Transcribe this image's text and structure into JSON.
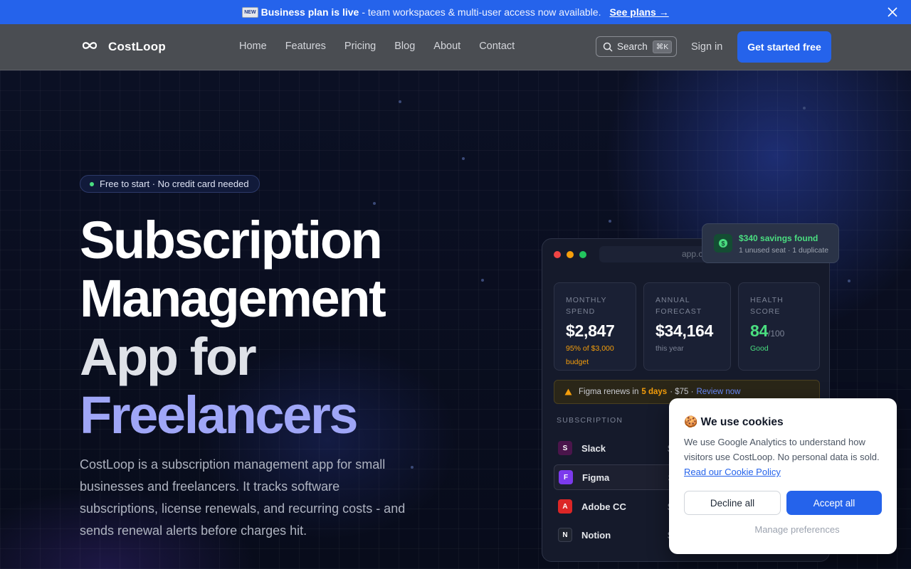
{
  "announcement": {
    "badge": "NEW",
    "bold_text": "Business plan is live",
    "rest_text": "- team workspaces & multi-user access now available.",
    "link_text": "See plans →"
  },
  "nav": {
    "brand": "CostLoop",
    "links": [
      "Home",
      "Features",
      "Pricing",
      "Blog",
      "About",
      "Contact"
    ],
    "search_label": "Search",
    "search_shortcut": "⌘K",
    "signin": "Sign in",
    "cta": "Get started free"
  },
  "hero": {
    "pill": "Free to start · No credit card needed",
    "headline": [
      "Subscription",
      "Management",
      "App for",
      "Freelancers"
    ],
    "subtext": "CostLoop is a subscription management app for small businesses and freelancers. It tracks software subscriptions, license renewals, and recurring costs - and sends renewal alerts before charges hit."
  },
  "mockup": {
    "url": "app.costloop",
    "stats": [
      {
        "label_1": "MONTHLY",
        "label_2": "SPEND",
        "value": "$2,847",
        "sub_1": "95% of $3,000",
        "sub_2": "budget"
      },
      {
        "label_1": "ANNUAL",
        "label_2": "FORECAST",
        "value": "$34,164",
        "sub_1": "this year"
      },
      {
        "label_1": "HEALTH",
        "label_2": "SCORE",
        "value": "84",
        "unit": "/100",
        "sub_1": "Good"
      }
    ],
    "alert": {
      "prefix": "Figma renews in",
      "days": "5 days",
      "amount": "· $75 ·",
      "action": "Review now"
    },
    "table_header": "SUBSCRIPTION",
    "rows": [
      {
        "initial": "S",
        "name": "Slack",
        "amount": "$",
        "color": "#4a154b"
      },
      {
        "initial": "F",
        "name": "Figma",
        "amount": "$",
        "color": "#7c3aed"
      },
      {
        "initial": "A",
        "name": "Adobe CC",
        "amount": "$",
        "color": "#dc2626"
      },
      {
        "initial": "N",
        "name": "Notion",
        "amount": "$",
        "color": "#1f2430"
      }
    ]
  },
  "savings": {
    "title": "$340 savings found",
    "detail": "1 unused seat · 1 duplicate"
  },
  "cookie": {
    "title": "🍪 We use cookies",
    "body": "We use Google Analytics to understand how visitors use CostLoop. No personal data is sold.",
    "policy_link": "Read our Cookie Policy",
    "decline": "Decline all",
    "accept": "Accept all",
    "manage": "Manage preferences"
  },
  "colors": {
    "accent": "#2563eb",
    "headline_highlight": "#9fa6f7",
    "success": "#4ade80",
    "warning": "#f59e0b"
  }
}
